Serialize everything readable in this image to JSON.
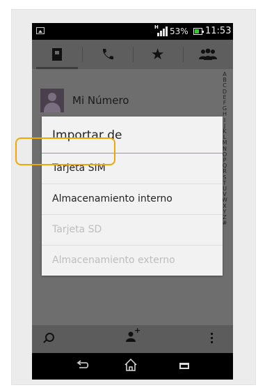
{
  "status_bar": {
    "network_type": "H",
    "battery_percent": "53%",
    "time": "11:53",
    "colors": {
      "battery_fill": "#33cc33"
    }
  },
  "tabs": [
    {
      "icon": "contacts-book-icon",
      "active": true
    },
    {
      "icon": "phone-icon",
      "active": false
    },
    {
      "icon": "star-icon",
      "active": false
    },
    {
      "icon": "groups-icon",
      "active": false
    }
  ],
  "contacts": {
    "my_number_label": "Mi Número",
    "index_letters": [
      "A",
      "B",
      "C",
      "D",
      "E",
      "F",
      "G",
      "H",
      "I",
      "J",
      "K",
      "L",
      "M",
      "N",
      "O",
      "P",
      "Q",
      "R",
      "S",
      "T",
      "U",
      "V",
      "W",
      "X",
      "Y",
      "Z",
      "#"
    ]
  },
  "dialog": {
    "title": "Importar de",
    "accent_color": "#33b5e5",
    "options": [
      {
        "label": "Tarjeta SIM",
        "enabled": true,
        "highlighted": true
      },
      {
        "label": "Almacenamiento interno",
        "enabled": true,
        "highlighted": false
      },
      {
        "label": "Tarjeta SD",
        "enabled": false,
        "highlighted": false
      },
      {
        "label": "Almacenamiento externo",
        "enabled": false,
        "highlighted": false
      }
    ],
    "highlight_color": "#f0a800"
  },
  "bottom_actions": [
    {
      "icon": "search-icon"
    },
    {
      "icon": "add-contact-icon"
    },
    {
      "icon": "overflow-menu-icon"
    }
  ],
  "nav_buttons": [
    {
      "icon": "back-icon"
    },
    {
      "icon": "home-icon"
    },
    {
      "icon": "recent-apps-icon"
    }
  ]
}
